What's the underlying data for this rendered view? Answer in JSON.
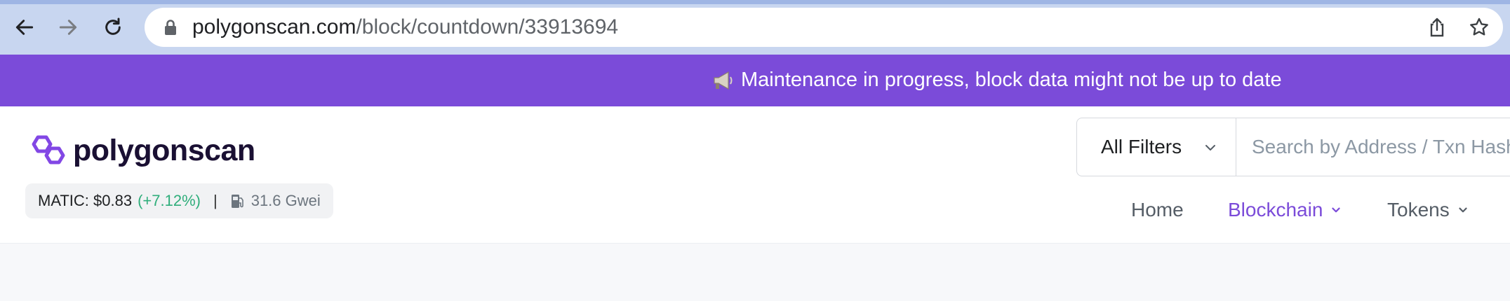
{
  "browser": {
    "url_domain": "polygonscan.com",
    "url_path": "/block/countdown/33913694",
    "back_icon": "arrow-left-icon",
    "forward_icon": "arrow-right-icon",
    "reload_icon": "reload-icon",
    "share_icon": "share-icon",
    "bookmark_icon": "star-icon"
  },
  "banner": {
    "icon": "megaphone-icon",
    "text": "Maintenance in progress, block data might not be up to date",
    "color": "#7b4bd9"
  },
  "header": {
    "logo_text": "polygonscan",
    "price": {
      "label": "MATIC: $0.83",
      "change": "(+7.12%)",
      "separator": "|",
      "gas": "31.6 Gwei"
    },
    "filter": {
      "label": "All Filters"
    },
    "search": {
      "placeholder": "Search by Address / Txn Hash / Block / Token / Domain Name"
    },
    "nav": {
      "home": "Home",
      "blockchain": "Blockchain",
      "tokens": "Tokens"
    },
    "accent_color": "#7b4bd9",
    "positive_color": "#2fae7b"
  }
}
